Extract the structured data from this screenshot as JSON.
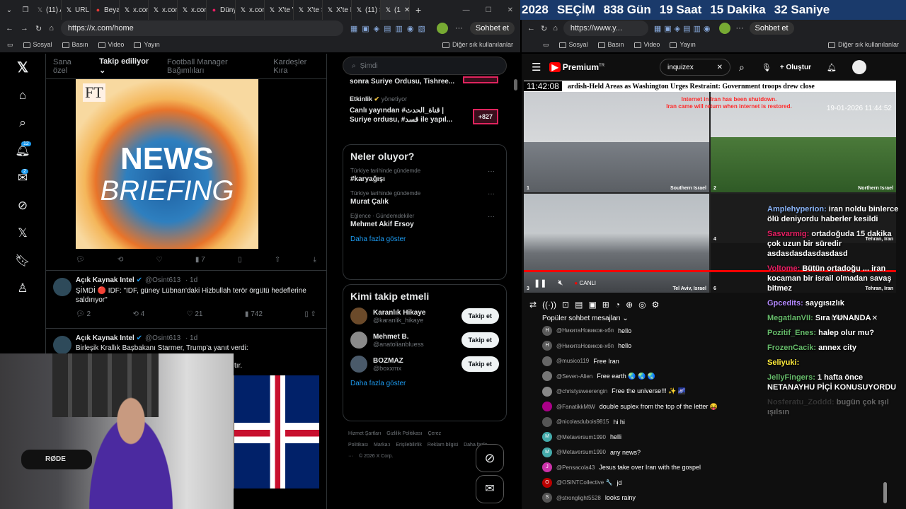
{
  "browser_left": {
    "tabs": [
      "(11) A",
      "URL I",
      "Beya:",
      "x.con",
      "x.con",
      "x.con",
      "Düny",
      "x.con",
      "X'te V",
      "X'te S",
      "X'te E",
      "(11) >",
      "(1"
    ],
    "url": "https://x.com/home",
    "bookmarks": [
      "Sosyal",
      "Basın",
      "Video",
      "Yayın"
    ],
    "other_bookmarks": "Diğer sık kullanılanlar",
    "chat_button": "Sohbet et"
  },
  "x_sidebar": {
    "notif_badge": "12",
    "mail_badge": "2"
  },
  "x_feed": {
    "tabs": [
      "Sana özel",
      "Takip ediliyor",
      "Football Manager Bağımlıları",
      "Kardeşler Kıra"
    ],
    "ft_logo": "FT",
    "briefing_line1": "NEWS",
    "briefing_line2": "BRIEFING",
    "post0_views": "7",
    "posts": [
      {
        "name": "Açık Kaynak Intel",
        "handle": "@Osint613",
        "time": "· 1d",
        "text": "ŞİMDİ 🔴 IDF: \"IDF, güney Lübnan'daki Hizbullah terör örgütü hedeflerine saldırıyor\"",
        "replies": "2",
        "reposts": "4",
        "likes": "21",
        "views": "742"
      },
      {
        "name": "Açık Kaynak Intel",
        "handle": "@Osint613",
        "time": "· 1d",
        "text": "Birleşik Krallık Başbakanı Starmer, Trump'a yanıt verdi:",
        "tail": "tır."
      }
    ]
  },
  "x_right": {
    "search_placeholder": "Şimdi",
    "top_snippet": "sonra Suriye Ordusu, Tishree...",
    "event_label": "Etkinlik",
    "event_manages": "yönetiyor",
    "event_text": "Canlı yayından #قناة_الحدث | Suriye ordusu, #قسد ile yapıl...",
    "event_count": "+827",
    "trends_title": "Neler oluyor?",
    "trends": [
      {
        "ctx": "Türkiye tarihinde gündemde",
        "title": "#karyağışı"
      },
      {
        "ctx": "Türkiye tarihinde gündemde",
        "title": "Murat Çalık"
      },
      {
        "ctx": "Eğlence · Gündemdekiler",
        "title": "Mehmet Akif Ersoy"
      }
    ],
    "show_more": "Daha fazla göster",
    "follow_title": "Kimi takip etmeli",
    "follow": [
      {
        "name": "Karanlık Hikaye",
        "handle": "@karanlik_hikaye",
        "btn": "Takip et"
      },
      {
        "name": "Mehmet B.",
        "handle": "@anatolianbluess",
        "btn": "Takip et"
      },
      {
        "name": "BOZMAZ",
        "handle": "@boxxmx",
        "btn": "Takip et"
      }
    ],
    "footer": [
      "Hizmet Şartları",
      "Gizlilik Politikası",
      "Çerez Politikası",
      "Marka:ı",
      "Erişilebilirlik",
      "Reklam bilgisi",
      "Daha fazla ···",
      "© 2026 X Corp."
    ]
  },
  "countdown": {
    "year": "2028",
    "label": "SEÇİM",
    "days": "838 Gün",
    "hours": "19 Saat",
    "minutes": "15 Dakika",
    "seconds": "32 Saniye"
  },
  "browser_right": {
    "url": "https://www.y...",
    "bookmarks": [
      "Sosyal",
      "Basın",
      "Video",
      "Yayın"
    ],
    "other_bookmarks": "Diğer sık kullanılanlar",
    "chat_button": "Sohbet et"
  },
  "youtube": {
    "brand": "Premium",
    "brand_region": "TR",
    "search_value": "inquizex",
    "create": "Oluştur",
    "ticker_time": "11:42:08",
    "ticker_text": "ardish-Held Areas as Washington Urges Restraint: Government troops drew close",
    "timestamp": "19-01-2026 11:44:52",
    "banner1": "Internet in Iran has been shutdown.",
    "banner2": "Iran came will return when internet is restored.",
    "cams": [
      {
        "num": "1",
        "label": "Southern Israel"
      },
      {
        "num": "2",
        "label": "Northern Israel"
      },
      {
        "num": "3",
        "label": "Tel Aviv, Israel"
      },
      {
        "num": "4",
        "label": "Tehran, Iran"
      },
      {
        "num": "5",
        "label": "Tehran, Iran"
      },
      {
        "num": "6",
        "label": "Tehran, Iran"
      }
    ],
    "live_label": "CANLI",
    "chat_header": "Popüler sohbet mesajları",
    "xp": "0XP",
    "chat": [
      {
        "user": "@НикитаНовиков-хбп",
        "msg": "hello",
        "color": "#5a5a5a",
        "init": "H"
      },
      {
        "user": "@НикитаНовиков-хбп",
        "msg": "hello",
        "color": "#5a5a5a",
        "init": "H"
      },
      {
        "user": "@musico119",
        "msg": "Free Iran",
        "color": "#666",
        "init": ""
      },
      {
        "user": "@Seven-Alien",
        "msg": "Free earth 🌏 🌏 🌏",
        "color": "#777",
        "init": ""
      },
      {
        "user": "@christysweerengin",
        "msg": "Free the universe!!! ✨ 🌌",
        "color": "#888",
        "init": ""
      },
      {
        "user": "@FanatikkMtW",
        "msg": "double suplex from the top of the letter 😝",
        "color": "#a08",
        "init": ""
      },
      {
        "user": "@nicolasdubois9815",
        "msg": "hi hi",
        "color": "#555",
        "init": ""
      },
      {
        "user": "@Metaversum1990",
        "msg": "helli",
        "color": "#4aa",
        "init": "M"
      },
      {
        "user": "@Metaversum1990",
        "msg": "any news?",
        "color": "#4aa",
        "init": "M"
      },
      {
        "user": "@Pensacola43",
        "msg": "Jesus take over Iran with the gospel",
        "color": "#c3a",
        "init": "J"
      },
      {
        "user": "@OSINTCollective 🔧",
        "msg": "jd",
        "color": "#b00",
        "init": "O"
      },
      {
        "user": "@stronglight5528",
        "msg": "looks rainy",
        "color": "#555",
        "init": "S"
      }
    ],
    "overlay": [
      {
        "user": "Amplehyperion:",
        "msg": "iran noldu binlerce ölü deniyordu haberler kesildi",
        "ucolor": "#8ab4f8"
      },
      {
        "user": "Sasvarmig:",
        "msg": "ortadoğuda 15 dakika çok uzun bir süredir asdasdasdasdasdasd",
        "ucolor": "#e91e63"
      },
      {
        "user": "Voltome:",
        "msg": "Bütün ortadoğu ... iran kocaman bir israil olmadan savaş bitmez",
        "ucolor": "#e91e63"
      },
      {
        "user": "Gpcedits:",
        "msg": "saygısızlık",
        "ucolor": "#b388ff"
      },
      {
        "user": "MegatlanVII:",
        "msg": "Sıra YUNANDA",
        "ucolor": "#66bb6a"
      },
      {
        "user": "Pozitif_Enes:",
        "msg": "halep olur mu?",
        "ucolor": "#66bb6a"
      },
      {
        "user": "FrozenCacik:",
        "msg": "annex city",
        "ucolor": "#66bb6a"
      },
      {
        "user": "Seliyuki:",
        "msg": "",
        "ucolor": "#ffeb3b"
      },
      {
        "user": "JellyFingers:",
        "msg": "1 hafta önce NETANAYHU PİÇİ KONUSUYORDU",
        "ucolor": "#66bb6a"
      },
      {
        "user": "Nosferatu_Zoddd:",
        "msg": "bugün çok ışıl ışılsın",
        "ucolor": "#777"
      }
    ]
  },
  "webcam": {
    "mic_brand": "RØDE"
  }
}
